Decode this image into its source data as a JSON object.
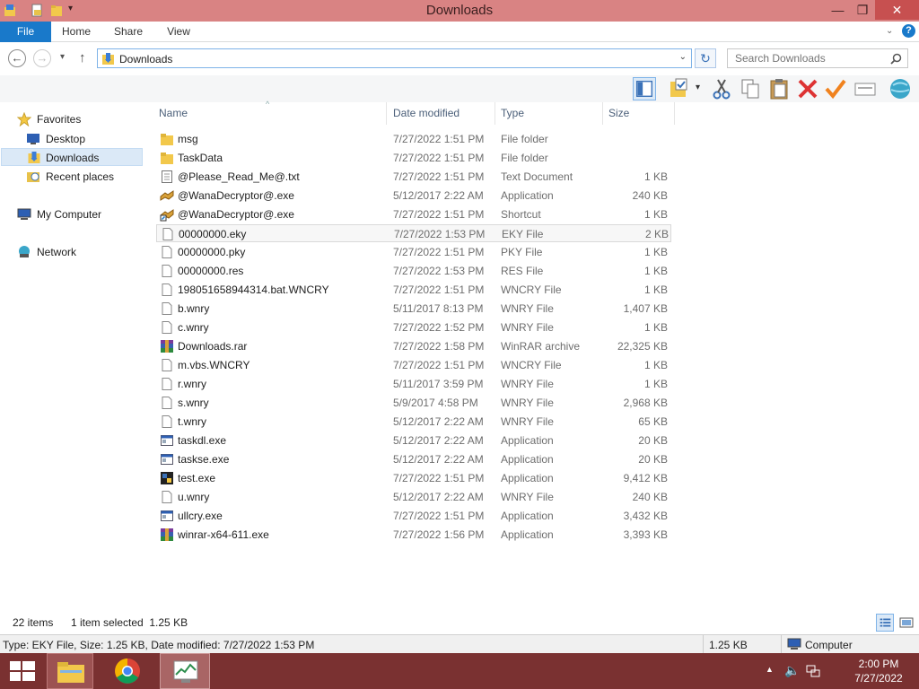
{
  "window": {
    "title": "Downloads"
  },
  "window_controls": {
    "minimize": "—",
    "maximize": "❐",
    "close": "✕"
  },
  "ribbon": {
    "tabs": [
      "File",
      "Home",
      "Share",
      "View"
    ],
    "help_icon": "help-icon"
  },
  "address": {
    "path": "Downloads"
  },
  "search": {
    "placeholder": "Search Downloads"
  },
  "nav": {
    "favorites": "Favorites",
    "desktop": "Desktop",
    "downloads": "Downloads",
    "recent": "Recent places",
    "computer": "My Computer",
    "network": "Network"
  },
  "columns": {
    "name": "Name",
    "date": "Date modified",
    "type": "Type",
    "size": "Size"
  },
  "files": [
    {
      "name": "msg",
      "date": "7/27/2022 1:51 PM",
      "type": "File folder",
      "size": "",
      "icon": "folder"
    },
    {
      "name": "TaskData",
      "date": "7/27/2022 1:51 PM",
      "type": "File folder",
      "size": "",
      "icon": "folder"
    },
    {
      "name": "@Please_Read_Me@.txt",
      "date": "7/27/2022 1:51 PM",
      "type": "Text Document",
      "size": "1 KB",
      "icon": "text"
    },
    {
      "name": "@WanaDecryptor@.exe",
      "date": "5/12/2017 2:22 AM",
      "type": "Application",
      "size": "240 KB",
      "icon": "wana"
    },
    {
      "name": "@WanaDecryptor@.exe",
      "date": "7/27/2022 1:51 PM",
      "type": "Shortcut",
      "size": "1 KB",
      "icon": "shortcut"
    },
    {
      "name": "00000000.eky",
      "date": "7/27/2022 1:53 PM",
      "type": "EKY File",
      "size": "2 KB",
      "icon": "blank",
      "selected": true
    },
    {
      "name": "00000000.pky",
      "date": "7/27/2022 1:51 PM",
      "type": "PKY File",
      "size": "1 KB",
      "icon": "blank"
    },
    {
      "name": "00000000.res",
      "date": "7/27/2022 1:53 PM",
      "type": "RES File",
      "size": "1 KB",
      "icon": "blank"
    },
    {
      "name": "198051658944314.bat.WNCRY",
      "date": "7/27/2022 1:51 PM",
      "type": "WNCRY File",
      "size": "1 KB",
      "icon": "blank"
    },
    {
      "name": "b.wnry",
      "date": "5/11/2017 8:13 PM",
      "type": "WNRY File",
      "size": "1,407 KB",
      "icon": "blank"
    },
    {
      "name": "c.wnry",
      "date": "7/27/2022 1:52 PM",
      "type": "WNRY File",
      "size": "1 KB",
      "icon": "blank"
    },
    {
      "name": "Downloads.rar",
      "date": "7/27/2022 1:58 PM",
      "type": "WinRAR archive",
      "size": "22,325 KB",
      "icon": "rar"
    },
    {
      "name": "m.vbs.WNCRY",
      "date": "7/27/2022 1:51 PM",
      "type": "WNCRY File",
      "size": "1 KB",
      "icon": "blank"
    },
    {
      "name": "r.wnry",
      "date": "5/11/2017 3:59 PM",
      "type": "WNRY File",
      "size": "1 KB",
      "icon": "blank"
    },
    {
      "name": "s.wnry",
      "date": "5/9/2017 4:58 PM",
      "type": "WNRY File",
      "size": "2,968 KB",
      "icon": "blank"
    },
    {
      "name": "t.wnry",
      "date": "5/12/2017 2:22 AM",
      "type": "WNRY File",
      "size": "65 KB",
      "icon": "blank"
    },
    {
      "name": "taskdl.exe",
      "date": "5/12/2017 2:22 AM",
      "type": "Application",
      "size": "20 KB",
      "icon": "app"
    },
    {
      "name": "taskse.exe",
      "date": "5/12/2017 2:22 AM",
      "type": "Application",
      "size": "20 KB",
      "icon": "app"
    },
    {
      "name": "test.exe",
      "date": "7/27/2022 1:51 PM",
      "type": "Application",
      "size": "9,412 KB",
      "icon": "python"
    },
    {
      "name": "u.wnry",
      "date": "5/12/2017 2:22 AM",
      "type": "WNRY File",
      "size": "240 KB",
      "icon": "blank"
    },
    {
      "name": "ullcry.exe",
      "date": "7/27/2022 1:51 PM",
      "type": "Application",
      "size": "3,432 KB",
      "icon": "app"
    },
    {
      "name": "winrar-x64-611.exe",
      "date": "7/27/2022 1:56 PM",
      "type": "Application",
      "size": "3,393 KB",
      "icon": "rar"
    }
  ],
  "status": {
    "count": "22 items",
    "selected": "1 item selected  1.25 KB"
  },
  "details": {
    "info": "Type: EKY File, Size: 1.25 KB, Date modified: 7/27/2022 1:53 PM",
    "size": "1.25 KB",
    "location": "Computer"
  },
  "taskbar": {
    "time": "2:00 PM",
    "date": "7/27/2022"
  },
  "colors": {
    "titlebar": "#d98383",
    "file_tab": "#1979ca",
    "taskbar": "#7a3131",
    "selection": "#dbe9f7"
  }
}
